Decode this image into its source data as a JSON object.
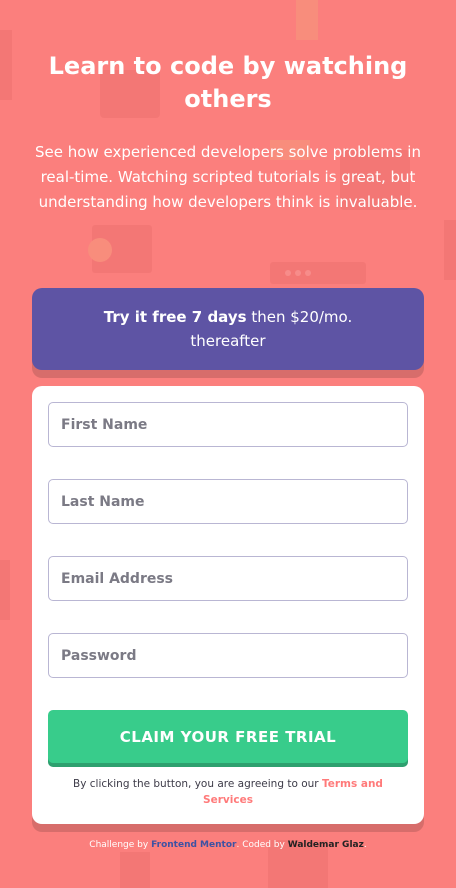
{
  "colors": {
    "background": "#fb7f7d",
    "promo": "#5e54a4",
    "button": "#38cc8b",
    "terms_link": "#ff7a7a"
  },
  "hero": {
    "title": "Learn to code by watching others",
    "description": "See how experienced developers solve problems in real-time. Watching scripted tutorials is great, but understanding how developers think is invaluable."
  },
  "promo": {
    "highlight": "Try it free 7 days",
    "rest": "then $20/mo. thereafter"
  },
  "form": {
    "first_name_placeholder": "First Name",
    "last_name_placeholder": "Last Name",
    "email_placeholder": "Email Address",
    "password_placeholder": "Password",
    "submit_label": "CLAIM YOUR FREE TRIAL",
    "terms_prefix": "By clicking the button, you are agreeing to our",
    "terms_link": "Terms and Services"
  },
  "footer": {
    "challenge_prefix": "Challenge by",
    "challenge_link": "Frontend Mentor",
    "coded_prefix": "Coded by",
    "coded_link": "Waldemar Glaz"
  }
}
